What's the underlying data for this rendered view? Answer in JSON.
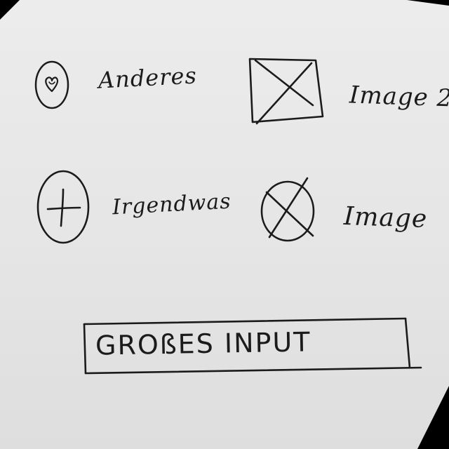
{
  "items": {
    "anderes": {
      "label": "Anderes",
      "icon": "heart-icon"
    },
    "irgendwas": {
      "label": "Irgendwas",
      "icon": "plus-icon"
    },
    "image2": {
      "label": "Image 2",
      "icon": "image-placeholder-icon"
    },
    "image": {
      "label": "Image",
      "icon": "image-placeholder-icon"
    }
  },
  "input": {
    "value": "GROßES INPUT"
  },
  "colors": {
    "ink": "#1b1b1b",
    "paper": "#e9e9e9"
  }
}
